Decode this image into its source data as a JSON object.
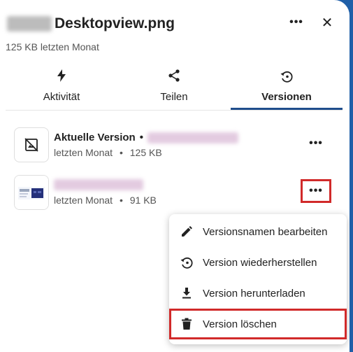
{
  "header": {
    "title": "Desktopview.png",
    "subtitle": "125 KB letzten Monat",
    "more_icon": "more-horizontal-icon",
    "close_icon": "close-icon",
    "more_label": "•••",
    "close_label": "✕"
  },
  "tabs": [
    {
      "label": "Aktivität",
      "icon": "lightning-icon"
    },
    {
      "label": "Teilen",
      "icon": "share-icon"
    },
    {
      "label": "Versionen",
      "icon": "history-icon",
      "active": true
    }
  ],
  "versions": [
    {
      "title": "Aktuelle Version",
      "separator": "•",
      "date": "letzten Monat",
      "size": "125 KB",
      "dot": "•",
      "more_label": "•••"
    },
    {
      "date": "letzten Monat",
      "size": "91 KB",
      "dot": "•",
      "more_label": "•••"
    }
  ],
  "menu": {
    "items": [
      {
        "label": "Versionsnamen bearbeiten",
        "icon": "pencil-icon"
      },
      {
        "label": "Version wiederherstellen",
        "icon": "restore-icon"
      },
      {
        "label": "Version herunterladen",
        "icon": "download-icon"
      },
      {
        "label": "Version löschen",
        "icon": "trash-icon"
      }
    ]
  },
  "colors": {
    "accent": "#1f4e8c",
    "highlight": "#d12a2a",
    "background_right": "#1f5fa8"
  }
}
